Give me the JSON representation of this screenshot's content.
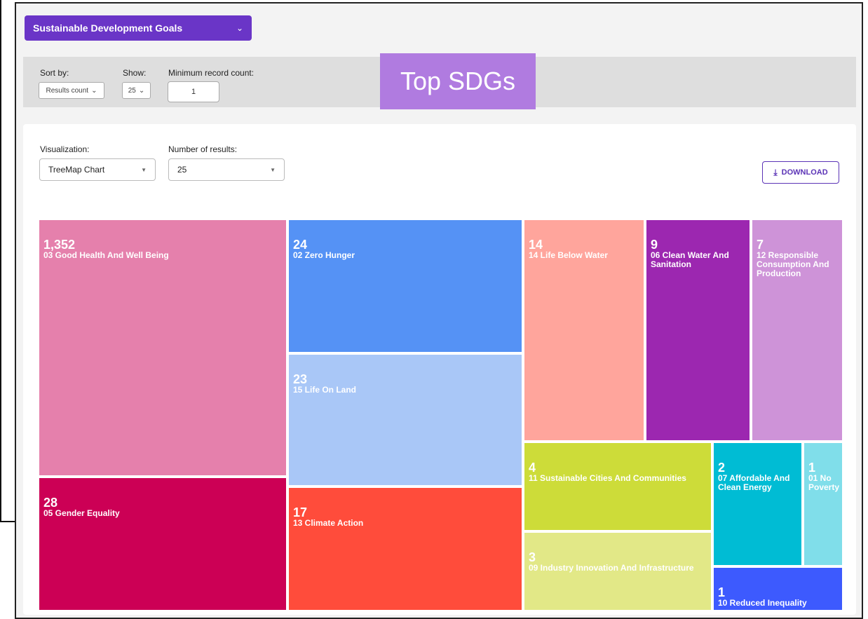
{
  "header": {
    "sdg_select_label": "Sustainable Development Goals",
    "sdg_select_chevron": "⌄"
  },
  "filters": {
    "sort_label": "Sort by:",
    "sort_value": "Results count",
    "show_label": "Show:",
    "show_value": "25",
    "min_label": "Minimum record count:",
    "min_value": "1"
  },
  "banner": {
    "text": "Top SDGs"
  },
  "card": {
    "visualization_label": "Visualization:",
    "visualization_value": "TreeMap Chart",
    "results_label": "Number of results:",
    "results_value": "25",
    "download_label": "DOWNLOAD"
  },
  "chart_data": {
    "type": "treemap",
    "items": [
      {
        "label": "03 Good Health And Well Being",
        "value": "1,352",
        "color": "#e580ac"
      },
      {
        "label": "05 Gender Equality",
        "value": "28",
        "color": "#cc0055"
      },
      {
        "label": "02 Zero Hunger",
        "value": "24",
        "color": "#5592f5"
      },
      {
        "label": "15 Life On Land",
        "value": "23",
        "color": "#a9c7f7"
      },
      {
        "label": "13 Climate Action",
        "value": "17",
        "color": "#ff4c3b"
      },
      {
        "label": "14 Life Below Water",
        "value": "14",
        "color": "#ffa59c"
      },
      {
        "label": "06 Clean Water And Sanitation",
        "value": "9",
        "color": "#9c27b0"
      },
      {
        "label": "12 Responsible Consumption And Production",
        "value": "7",
        "color": "#ce93d8"
      },
      {
        "label": "11 Sustainable Cities And Communities",
        "value": "4",
        "color": "#cddc39"
      },
      {
        "label": "09 Industry Innovation And Infrastructure",
        "value": "3",
        "color": "#e2e887"
      },
      {
        "label": "07 Affordable And Clean Energy",
        "value": "2",
        "color": "#00bcd4"
      },
      {
        "label": "01 No Poverty",
        "value": "1",
        "color": "#80deea"
      },
      {
        "label": "10 Reduced Inequality",
        "value": "1",
        "color": "#3d5afe"
      }
    ]
  }
}
